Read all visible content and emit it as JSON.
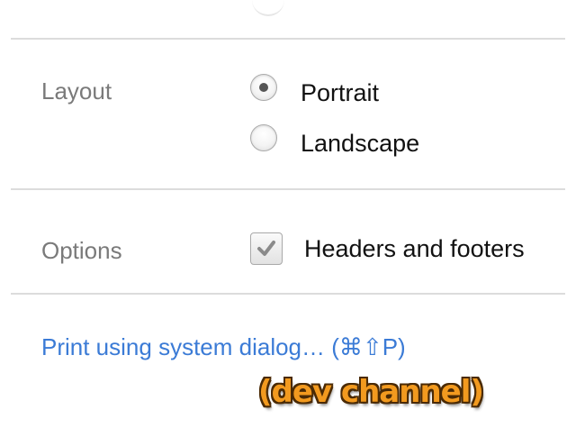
{
  "layout_section": {
    "label": "Layout",
    "options": [
      {
        "label": "Portrait",
        "selected": true
      },
      {
        "label": "Landscape",
        "selected": false
      }
    ]
  },
  "options_section": {
    "label": "Options",
    "headers_footers": {
      "label": "Headers and footers",
      "checked": true
    }
  },
  "system_dialog_link": "Print using system dialog… (⌘⇧P)",
  "overlay_badge": "(dev channel)",
  "colors": {
    "link": "#3b7bd6",
    "section_label": "#7a7a7a",
    "divider": "#dcdcdc",
    "badge_fill": "#f29a1f",
    "badge_outline": "#4a2a05"
  }
}
